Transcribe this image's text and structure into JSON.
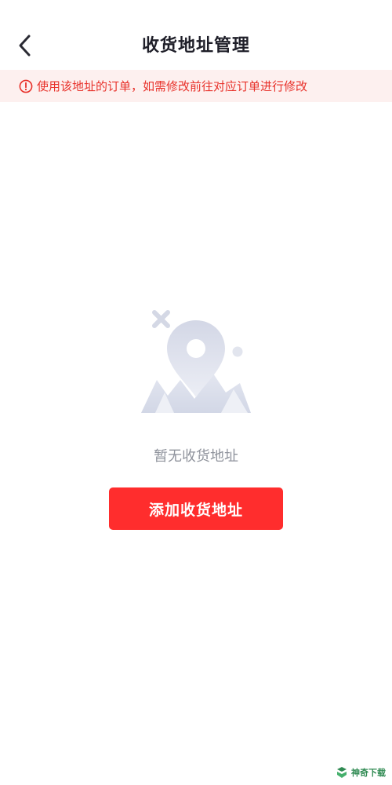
{
  "header": {
    "title": "收货地址管理",
    "back_icon": "chevron-left-icon"
  },
  "notice": {
    "icon": "info-circle-icon",
    "text": "使用该地址的订单，如需修改前往对应订单进行修改",
    "color": "#e8312a",
    "background": "#fdf0ef"
  },
  "empty_state": {
    "illustration": "map-pin-empty-illustration",
    "message": "暂无收货地址"
  },
  "actions": {
    "add_address_label": "添加收货地址",
    "button_color": "#ff2d2d"
  },
  "watermark": {
    "text": "神奇下载"
  }
}
